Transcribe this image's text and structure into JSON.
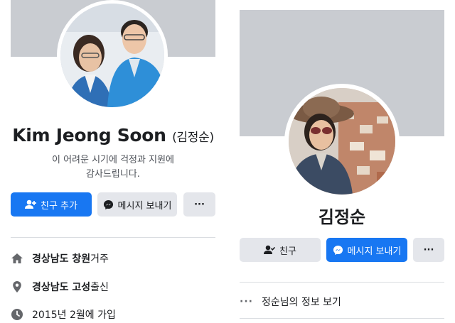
{
  "left_profile": {
    "name": "Kim Jeong Soon",
    "name_alt": "(김정순)",
    "bio_line1": "이 어려운 시기에 걱정과 지원에",
    "bio_line2": "감사드립니다.",
    "add_friend_label": "친구 추가",
    "message_label": "메시지 보내기",
    "more_label": "···",
    "info": [
      {
        "icon": "home-icon",
        "bold": "경상남도 창원",
        "text": " 거주"
      },
      {
        "icon": "location-pin-icon",
        "bold": "경상남도 고성",
        "text": " 출신"
      },
      {
        "icon": "clock-icon",
        "bold": "",
        "text": "2015년 2월에 가입"
      }
    ]
  },
  "right_profile": {
    "name": "김정순",
    "friend_label": "친구",
    "message_label": "메시지 보내기",
    "more_label": "···",
    "see_info_label": "정순님의 정보 보기",
    "see_info_dots": "···"
  },
  "colors": {
    "primary": "#1877f2",
    "button_gray": "#e4e6eb",
    "cover_gray": "#c9ccd1",
    "divider": "#dadde1"
  }
}
